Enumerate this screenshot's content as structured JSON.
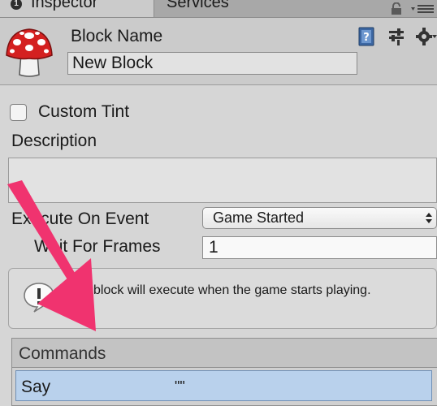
{
  "tabs": [
    {
      "label": "Inspector",
      "icon": "inspector-number-icon",
      "active": true
    },
    {
      "label": "Services",
      "active": false
    }
  ],
  "header": {
    "block_name_label": "Block Name",
    "block_name_value": "New Block",
    "icons": [
      "mushroom-icon",
      "help-book-icon",
      "presets-icon",
      "gear-icon"
    ]
  },
  "fields": {
    "custom_tint_label": "Custom Tint",
    "description_label": "Description",
    "description_value": "",
    "execute_on_event_label": "Execute On Event",
    "execute_on_event_value": "Game Started",
    "wait_for_frames_label": "Wait For Frames",
    "wait_for_frames_value": "1"
  },
  "help_box": {
    "text": "The block will execute when the game starts playing."
  },
  "commands": {
    "title": "Commands",
    "rows": [
      {
        "name": "Say",
        "summary": "\"\""
      }
    ]
  },
  "colors": {
    "selection": "#b9d1ec",
    "annotation_arrow": "#f0336f",
    "mushroom_red": "#d42020"
  }
}
